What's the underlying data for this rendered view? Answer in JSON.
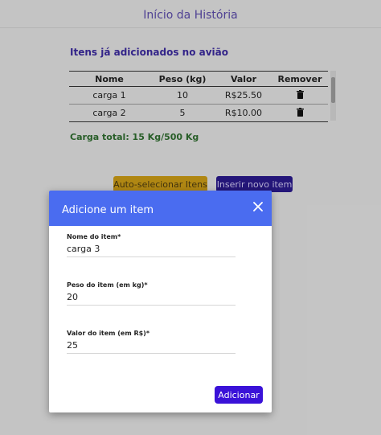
{
  "header": {
    "title": "Início da História"
  },
  "items_section": {
    "title": "Itens já adicionados no avião",
    "columns": [
      "Nome",
      "Peso (kg)",
      "Valor",
      "Remover"
    ],
    "rows": [
      {
        "nome": "carga 1",
        "peso": "10",
        "valor": "R$25.50",
        "remove_icon": "trash-icon"
      },
      {
        "nome": "carga 2",
        "peso": "5",
        "valor": "R$10.00",
        "remove_icon": "trash-icon"
      }
    ],
    "total": "Carga total: 15 Kg/500 Kg"
  },
  "actions": {
    "auto_label": "Auto-selecionar Itens",
    "insert_label": "Inserir novo item"
  },
  "modal": {
    "title": "Adicione um item",
    "close_icon": "close-icon",
    "fields": {
      "name": {
        "label": "Nome do item",
        "value": "carga 3"
      },
      "weight": {
        "label": "Peso do item (em kg)",
        "value": "20"
      },
      "value": {
        "label": "Valor do item (em R$)",
        "value": "25"
      }
    },
    "required_mark": "*",
    "submit_label": "Adicionar"
  },
  "colors": {
    "header_title": "#5a4ba8",
    "section_title": "#3b2a9c",
    "total": "#2e6b2e",
    "auto_button": "#c99a16",
    "insert_button": "#2a1a8a",
    "modal_header": "#4a6cf0",
    "add_button": "#3a12d8"
  }
}
